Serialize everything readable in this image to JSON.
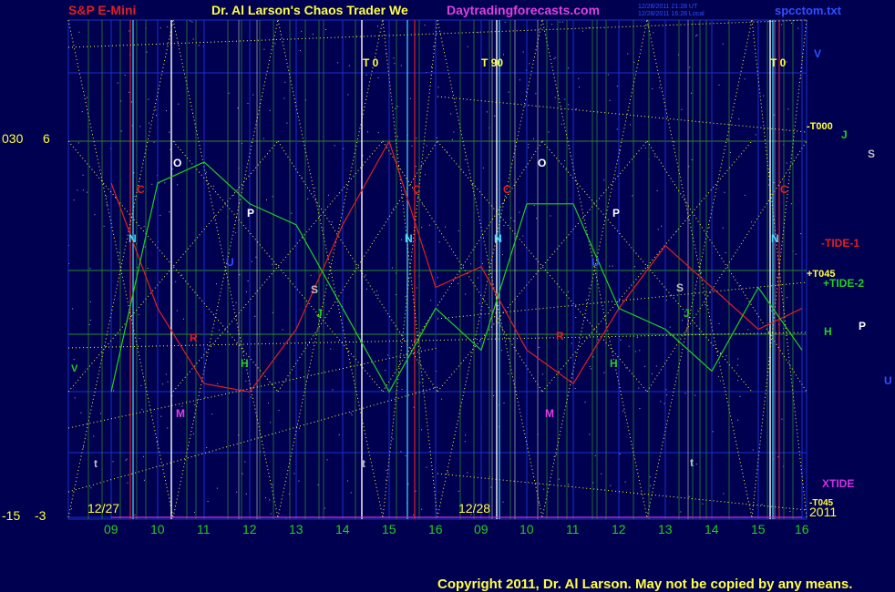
{
  "header": {
    "title_left": "S&P E-Mini",
    "title_center": "Dr. Al Larson's Chaos Trader We",
    "site": "Daytradingforecasts.com",
    "stamp_line1": "12/28/2011 21:28 UT",
    "stamp_line2": "12/28/2011 16:28 Local",
    "filename": "spcctom.txt"
  },
  "footer": {
    "copyright": "Copyright 2011, Dr. Al Larson. May not be copied by any means.",
    "year": "2011"
  },
  "left_scale": {
    "top_a": "030",
    "top_b": "6",
    "bottom_a": "-15",
    "bottom_b": "-3"
  },
  "dates": [
    "12/27",
    "12/28"
  ],
  "hours": [
    "09",
    "10",
    "11",
    "12",
    "13",
    "14",
    "15",
    "16",
    "09",
    "10",
    "11",
    "12",
    "13",
    "14",
    "15",
    "16"
  ],
  "t_labels": [
    "T  0",
    "T  90",
    "T  0"
  ],
  "right_labels": {
    "t000": "-T000",
    "j": "J",
    "s": "S",
    "tide1": "-TIDE-1",
    "t045": "+T045",
    "tide2": "+TIDE-2",
    "h": "H",
    "p": "P",
    "u": "U",
    "xtide": "XTIDE",
    "t045b": "-T045",
    "v": "V"
  },
  "planet_markers": [
    "O",
    "C",
    "P",
    "N",
    "U",
    "S",
    "J",
    "R",
    "H",
    "M",
    "t",
    "V"
  ],
  "colors": {
    "background": "#000050",
    "grid_blue": "#1a2fcc",
    "grid_green": "#2a8a2a",
    "red": "#e02020",
    "green": "#20d020",
    "magenta": "#d030e0",
    "yellow": "#ffff40",
    "cyan": "#40e0ff",
    "white": "#ffffff"
  },
  "chart_data": {
    "type": "line",
    "x": [
      "12/27 09",
      "12/27 10",
      "12/27 11",
      "12/27 12",
      "12/27 13",
      "12/27 14",
      "12/27 15",
      "12/27 16",
      "12/28 09",
      "12/28 10",
      "12/28 11",
      "12/28 12",
      "12/28 13",
      "12/28 14",
      "12/28 15",
      "12/28 16"
    ],
    "series": [
      {
        "name": "TIDE-1",
        "values": [
          5,
          2,
          0.2,
          0,
          1.5,
          4,
          6,
          2.5,
          3,
          1,
          0.2,
          2,
          3.5,
          2.5,
          1.5,
          2
        ]
      },
      {
        "name": "TIDE-2",
        "values": [
          0,
          5,
          5.5,
          4.5,
          4,
          2,
          0,
          2,
          1,
          4.5,
          4.5,
          2,
          1.5,
          0.5,
          2.5,
          1
        ]
      },
      {
        "name": "XTIDE",
        "values": [
          -13,
          -11,
          -13,
          -12,
          -13,
          -13,
          -13,
          -12,
          -13,
          -12,
          -12,
          -13,
          -12,
          -13,
          -13,
          -13
        ]
      }
    ],
    "ylim": [
      -3,
      6
    ]
  }
}
